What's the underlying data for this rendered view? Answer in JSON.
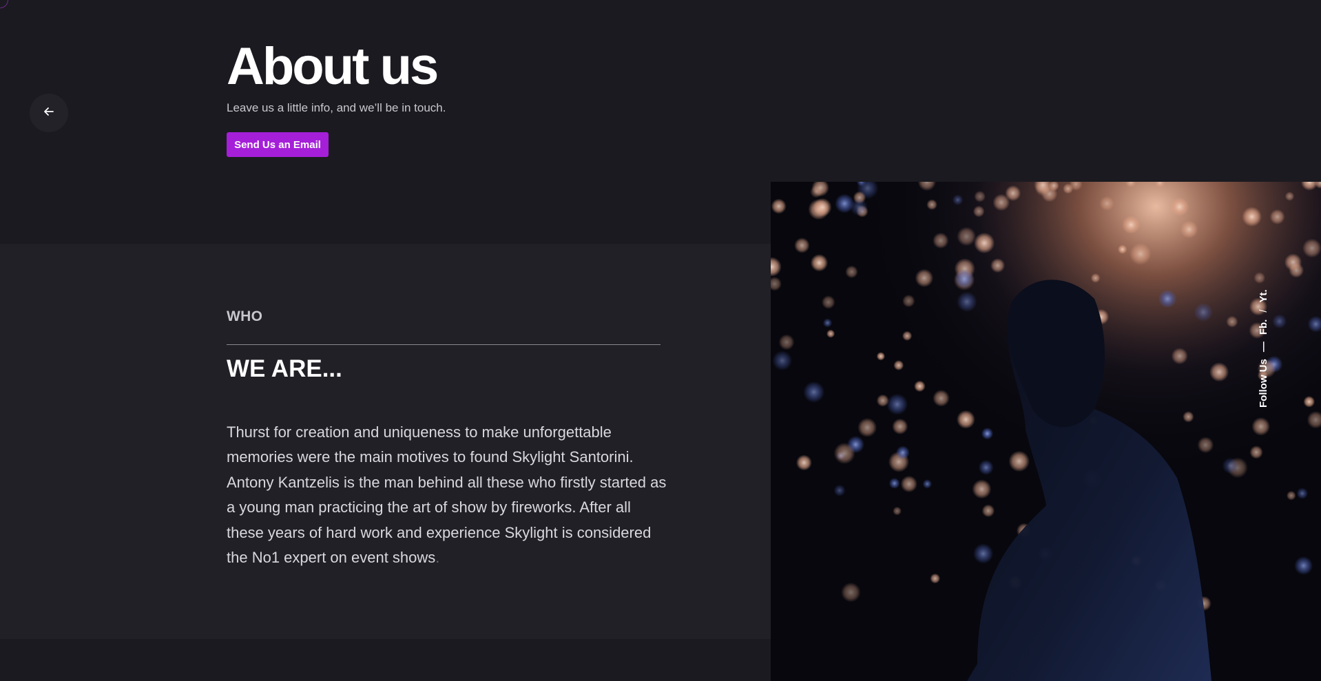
{
  "hero": {
    "title": "About us",
    "subtitle": "Leave us a little info, and we’ll be in touch.",
    "cta_label": "Send Us an Email"
  },
  "about": {
    "eyebrow": "WHO",
    "heading": "WE ARE...",
    "paragraph": "Thurst for creation and uniqueness to make unforgettable memories were the main motives to found Skylight Santorini. Antony Kantzelis is the man behind all these who firstly started as a young man practicing the art of show by fireworks. After all these years of hard work and experience Skylight is considered the No1 expert on event shows",
    "paragraph_end": "."
  },
  "social": {
    "label": "Follow Us",
    "dash": "—",
    "separator": "/",
    "links": [
      "Fb.",
      "Yt."
    ]
  },
  "icons": {
    "back": "arrow-left-icon"
  },
  "colors": {
    "background": "#1b1a20",
    "band": "#202026",
    "accent": "#a51fd9"
  }
}
